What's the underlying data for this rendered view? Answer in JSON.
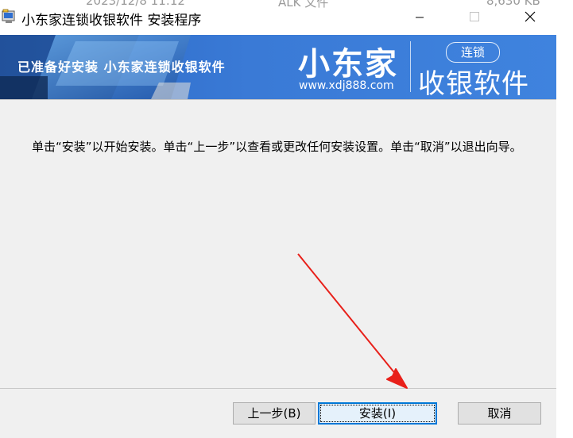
{
  "background_window": {
    "ghost_texts": [
      "2023/12/8 11:12",
      "ALK 文件",
      "8,630 KB"
    ]
  },
  "titlebar": {
    "title": "小东家连锁收银软件 安装程序",
    "icon": "installer-icon",
    "controls": {
      "minimize_icon": "minimize-icon",
      "maximize_icon": "maximize-icon",
      "close_icon": "close-icon"
    }
  },
  "banner": {
    "status": "已准备好安装 小东家连锁收银软件",
    "brand_name": "小东家",
    "brand_url": "www.xdj888.com",
    "brand_tag": "连锁",
    "brand_product": "收银软件",
    "colors": {
      "banner_blue": "#3a7ad6",
      "text": "#ffffff"
    }
  },
  "content": {
    "instructions": "单击“安装”以开始安装。单击“上一步”以查看或更改任何安装设置。单击“取消”以退出向导。"
  },
  "buttons": {
    "back": "上一步(B)",
    "install": "安装(I)",
    "cancel": "取消"
  },
  "annotation": {
    "arrow_color": "#e8201a",
    "points_to": "install-button"
  }
}
